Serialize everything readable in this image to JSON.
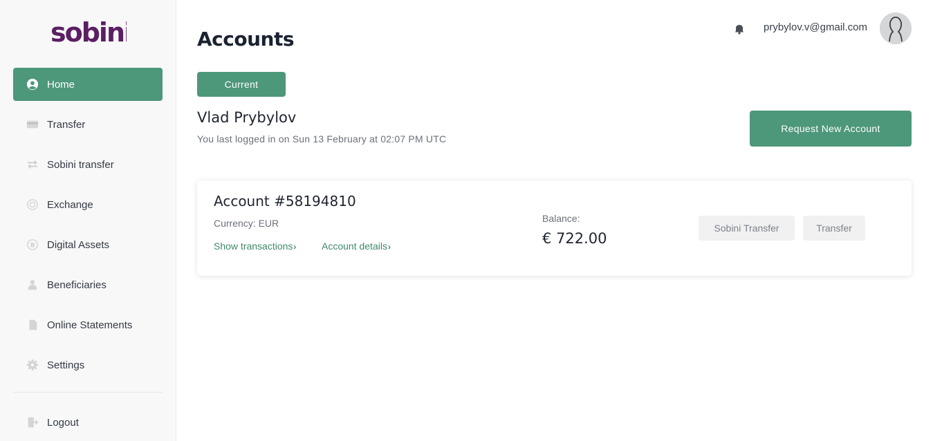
{
  "brand": {
    "logo_text": "sobini",
    "accent": "#4d977a",
    "logo_color": "#5b1e63"
  },
  "sidebar": {
    "items": [
      {
        "label": "Home",
        "icon": "user-circle-icon",
        "active": true
      },
      {
        "label": "Transfer",
        "icon": "card-icon",
        "active": false
      },
      {
        "label": "Sobini transfer",
        "icon": "arrows-exchange-icon",
        "active": false
      },
      {
        "label": "Exchange",
        "icon": "coins-icon",
        "active": false
      },
      {
        "label": "Digital Assets",
        "icon": "bitcoin-icon",
        "active": false
      },
      {
        "label": "Beneficiaries",
        "icon": "users-icon",
        "active": false
      },
      {
        "label": "Online Statements",
        "icon": "document-icon",
        "active": false
      },
      {
        "label": "Settings",
        "icon": "gear-icon",
        "active": false
      }
    ],
    "logout_label": "Logout"
  },
  "header": {
    "title": "Accounts",
    "user_email": "prybylov.v@gmail.com"
  },
  "tabs": {
    "current_label": "Current"
  },
  "profile": {
    "name": "Vlad Prybylov",
    "last_login": "You last logged in on Sun 13 February at 02:07 PM UTC"
  },
  "request_button_label": "Request New Account",
  "account": {
    "number": "Account #58194810",
    "currency": "Currency: EUR",
    "show_transactions_label": "Show transactions",
    "account_details_label": "Account details",
    "balance_label": "Balance:",
    "balance_value": "€ 722.00",
    "sobini_transfer_label": "Sobini Transfer",
    "transfer_label": "Transfer"
  }
}
